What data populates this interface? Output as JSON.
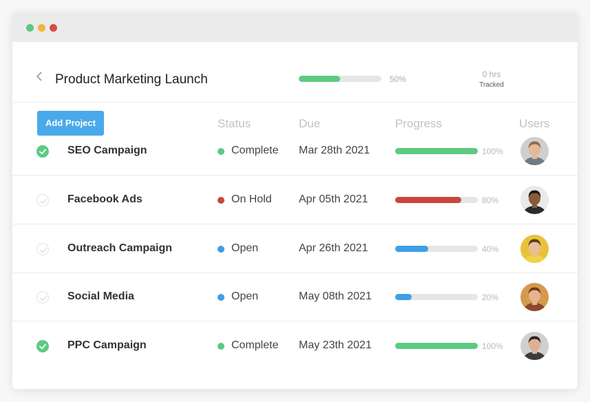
{
  "window": {
    "traffic_lights": [
      {
        "name": "green",
        "color": "#5dca82"
      },
      {
        "name": "yellow",
        "color": "#f1b73b"
      },
      {
        "name": "red",
        "color": "#d24d42"
      }
    ]
  },
  "header": {
    "back_icon": "chevron-left-icon",
    "title": "Product Marketing Launch",
    "progress": 0.5,
    "progress_label": "50%",
    "progress_color": "#5dca82",
    "tracked_hours": "0 hrs",
    "tracked_label": "Tracked"
  },
  "toolbar": {
    "add_project_label": "Add Project"
  },
  "columns": {
    "status": "Status",
    "due": "Due",
    "progress": "Progress",
    "users": "Users"
  },
  "status_colors": {
    "complete": "#5dca82",
    "on_hold": "#c9473f",
    "open": "#3f9ee6"
  },
  "tasks": [
    {
      "name": "SEO Campaign",
      "done": true,
      "status": "Complete",
      "status_key": "complete",
      "due": "Mar 28th 2021",
      "progress": 1.0,
      "progress_label": "100%",
      "avatar": {
        "skin": "#e2b99a",
        "hair": "#8a6a4a",
        "bg": "#cfcfcf",
        "shirt": "#6f7a84"
      }
    },
    {
      "name": "Facebook Ads",
      "done": false,
      "status": "On Hold",
      "status_key": "on_hold",
      "due": "Apr 05th 2021",
      "progress": 0.8,
      "progress_label": "80%",
      "avatar": {
        "skin": "#8a5a3c",
        "hair": "#1e1a18",
        "bg": "#e9e9e9",
        "shirt": "#2b2b2b"
      }
    },
    {
      "name": "Outreach Campaign",
      "done": false,
      "status": "Open",
      "status_key": "open",
      "due": "Apr 26th 2021",
      "progress": 0.4,
      "progress_label": "40%",
      "avatar": {
        "skin": "#e8bf9a",
        "hair": "#5a3a22",
        "bg": "#e8c23a",
        "shirt": "#f0d24a"
      }
    },
    {
      "name": "Social Media",
      "done": false,
      "status": "Open",
      "status_key": "open",
      "due": "May 08th 2021",
      "progress": 0.2,
      "progress_label": "20%",
      "avatar": {
        "skin": "#e6b48f",
        "hair": "#6b3a20",
        "bg": "#d49a4e",
        "shirt": "#8a4a2a"
      }
    },
    {
      "name": "PPC Campaign",
      "done": true,
      "status": "Complete",
      "status_key": "complete",
      "due": "May 23th 2021",
      "progress": 1.0,
      "progress_label": "100%",
      "avatar": {
        "skin": "#ddb195",
        "hair": "#2a2420",
        "bg": "#d0d0d0",
        "shirt": "#3b3b3b"
      }
    }
  ]
}
